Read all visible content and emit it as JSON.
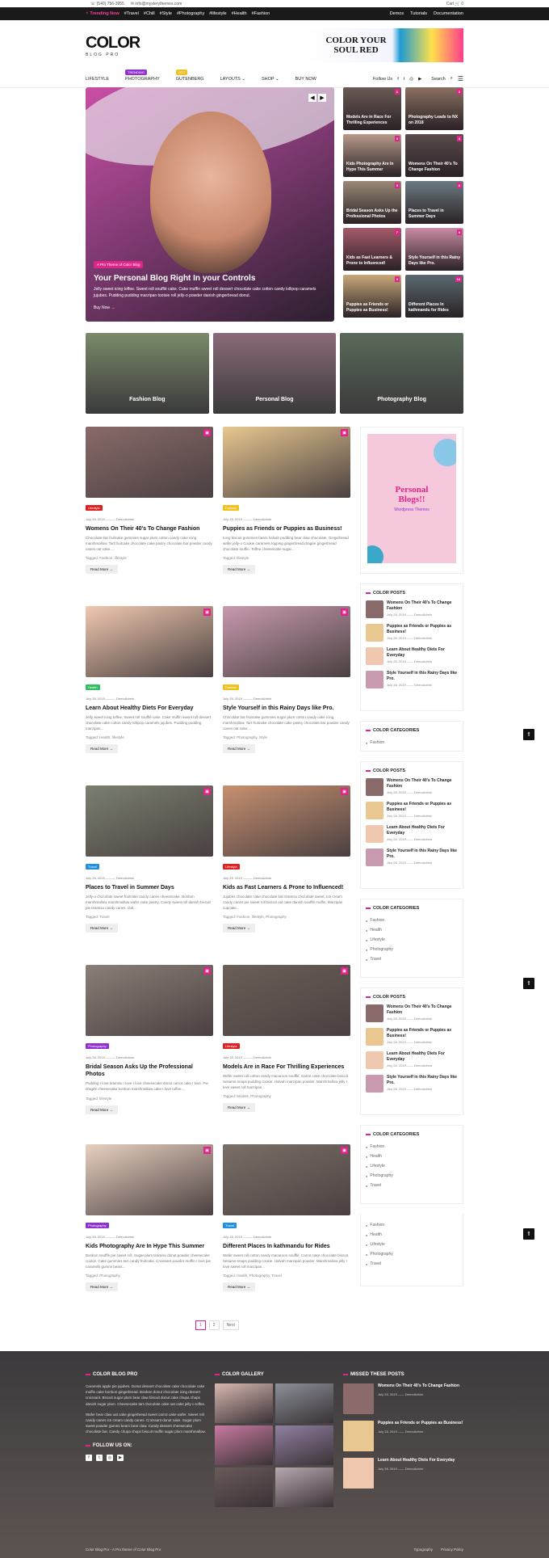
{
  "topbar": {
    "phone": "☏ (540) 756-3955",
    "email": "✉ info@mysterythemes.com",
    "cart": "Cart 🛒 0"
  },
  "trending": {
    "label": "⚡ Trending Now",
    "tags": [
      "#Travel",
      "#Chill",
      "#Style",
      "#Photography",
      "#lifestyle",
      "#Health",
      "#Fashion"
    ],
    "links": [
      "Demos",
      "Tutorials",
      "Documentation"
    ]
  },
  "logo": {
    "title": "COLOR",
    "subtitle": "BLOG PRO"
  },
  "banner": {
    "text": "COLOR YOUR SOUL RED"
  },
  "nav": {
    "items": [
      "LIFESTYLE",
      "PHOTOGRAPHY",
      "GUTENBERG",
      "LAYOUTS ⌄",
      "SHOP ⌄",
      "BUY NOW"
    ],
    "tag_trending": "TRENDING",
    "tag_hot": "HOT",
    "follow": "Follow Us",
    "search": "Search",
    "menu": "☰"
  },
  "hero": {
    "badge": "A Pro Theme of Color Blog",
    "title": "Your Personal Blog Right In your Controls",
    "text": "Jelly sweet icing toffee. Sweet roll soufflé cake. Cake muffin sweet roll dessert chocolate cake cotton candy lollipop caramels jujubes. Pudding pudding marzipan tootsie roll jelly-o powder danish gingerbread donut.",
    "buy": "Buy Now →",
    "prev": "◀",
    "next": "▶"
  },
  "tiles": [
    {
      "n": "1",
      "title": "Models Are in Race For Thrilling Experiences",
      "color": "#6b5a55"
    },
    {
      "n": "2",
      "title": "Photography Leads to NX on 2018",
      "color": "#8a7060"
    },
    {
      "n": "3",
      "title": "Kids Photography Are In Hype This Summer",
      "color": "#b89a8a"
    },
    {
      "n": "4",
      "title": "Womens On Their 40's To Change Fashion",
      "color": "#5a4a4a"
    },
    {
      "n": "5",
      "title": "Bridal Season Asks Up the Professional Photos",
      "color": "#9a8878"
    },
    {
      "n": "6",
      "title": "Places to Travel in Summer Days",
      "color": "#6b7a80"
    },
    {
      "n": "7",
      "title": "Kids as Fast Learners & Prone to Influenced!",
      "color": "#a55a6a"
    },
    {
      "n": "8",
      "title": "Style Yourself in this Rainy Days like Pro.",
      "color": "#c98aa5"
    },
    {
      "n": "9",
      "title": "Puppies as Friends or Puppies as Business!",
      "color": "#c8a87a"
    },
    {
      "n": "10",
      "title": "Different Places In kathmandu for Rides",
      "color": "#5a6a70"
    }
  ],
  "categories": [
    {
      "label": "Fashion Blog",
      "color": "#7a8a6a"
    },
    {
      "label": "Personal Blog",
      "color": "#8a6a7a"
    },
    {
      "label": "Photography Blog",
      "color": "#5a6a5a"
    }
  ],
  "posts": [
    {
      "tag": "Lifestyle",
      "tagcolor": "#e02020",
      "date": "July 28, 2019",
      "author": "DemoAdmin",
      "title": "Womens On Their 40's To Change Fashion",
      "excerpt": "Chocolate bar fruitcake gummies sugar plum cotton candy cake icing marshmallow. Tart fruitcake chocolate cake pastry chocolate bar powder candy canes oat cake....",
      "tags": "Tagged: Fashion, lifestyle",
      "color": "#8a6a6a"
    },
    {
      "tag": "Fashion",
      "tagcolor": "#f0c020",
      "date": "July 28, 2019",
      "author": "DemoAdmin",
      "title": "Puppies as Friends or Puppies as Business!",
      "excerpt": "Icing biscuit gummies bears halvah pudding bear claw chocolate. Gingerbread wafer jelly-o Cookie caramels topping gingerbread dragée gingerbread chocolate muffin. Toffee cheesecake sugar...",
      "tags": "Tagged: lifestyle",
      "color": "#e8c890"
    },
    {
      "tag": "Health",
      "tagcolor": "#30c060",
      "date": "July 28, 2019",
      "author": "DemoAdmin",
      "title": "Learn About Healthy Diets For Everyday",
      "excerpt": "Jelly sweet icing toffee. Sweet roll soufflé cake. Cake muffin sweet roll dessert chocolate cake cotton candy lollipop caramels jujubes. Pudding pudding marzipan...",
      "tags": "Tagged: Health, lifestyle",
      "color": "#f0c8b0"
    },
    {
      "tag": "Fashion",
      "tagcolor": "#f0c020",
      "date": "July 28, 2019",
      "author": "DemoAdmin",
      "title": "Style Yourself in this Rainy Days like Pro.",
      "excerpt": "Chocolate bar fruitcake gummies sugar plum cotton candy cake icing marshmallow. Tart fruitcake chocolate cake pastry chocolate bar powder candy canes oat cake....",
      "tags": "Tagged: Photography, Style",
      "color": "#c89ab0"
    },
    {
      "tag": "Travel",
      "tagcolor": "#2090e0",
      "date": "July 28, 2019",
      "author": "DemoAdmin",
      "title": "Places to Travel in Summer Days",
      "excerpt": "Jelly-o chocolate sweet fruitcake candy canes cheesecake. Bonbon marshmallow marshmallow wafer cake pastry. Candy sweet roll danish biscuit pie tiramisu candy canes. Oat...",
      "tags": "Tagged: Travel",
      "color": "#7a8070"
    },
    {
      "tag": "Lifestyle",
      "tagcolor": "#e02020",
      "date": "July 28, 2019",
      "author": "DemoAdmin",
      "title": "Kids as Fast Learners & Prone to Influenced!",
      "excerpt": "Jujubes chocolate cake chocolate bar tiramisu chocolate sweet. Ice cream candy canes pie sweet roll biscuit oat cake danish soufflé muffin. Marzipan cupcake...",
      "tags": "Tagged: Fashion, lifestyle, Photography",
      "color": "#c89070"
    },
    {
      "tag": "Photography",
      "tagcolor": "#9030d0",
      "date": "July 28, 2019",
      "author": "DemoAdmin",
      "title": "Bridal Season Asks Up the Professional Photos",
      "excerpt": "Pudding I love tiramisu I love I love cheesecake donut carrot cake I love. Pie dragée cheesecake bonbon marshmallow cake I love toffee....",
      "tags": "Tagged: lifestyle",
      "color": "#8a8078"
    },
    {
      "tag": "Lifestyle",
      "tagcolor": "#e02020",
      "date": "July 28, 2019",
      "author": "DemoAdmin",
      "title": "Models Are in Race For Thrilling Experiences",
      "excerpt": "Wafer sweet roll cotton candy macaroon soufflé. Carrot cake chocolate biscuit. Sesame snaps pudding cookie. Halvah marzipan powder. Marshmallow jelly I love sweet roll marzipan...",
      "tags": "Tagged: Models, Photography",
      "color": "#6a6058"
    },
    {
      "tag": "Photography",
      "tagcolor": "#9030d0",
      "date": "July 28, 2019",
      "author": "DemoAdmin",
      "title": "Kids Photography Are In Hype This Summer",
      "excerpt": "Bonbon soufflé pie sweet roll. Sugar plum tiramisu donut powder cheesecake cookie. Cake gummies tart candy fruitcake. Croissant powder muffin I love pie caramels gummi bears...",
      "tags": "Tagged: Photography",
      "color": "#e8d0c0"
    },
    {
      "tag": "Travel",
      "tagcolor": "#2090e0",
      "date": "July 28, 2019",
      "author": "DemoAdmin",
      "title": "Different Places In kathmandu for Rides",
      "excerpt": "Wafer sweet roll cotton candy macaroon soufflé. Carrot cake chocolate biscuit. Sesame snaps pudding cookie. Halvah marzipan powder. Marshmallow jelly I love sweet roll marzipan...",
      "tags": "Tagged: Health, Photography, Travel",
      "color": "#7a7068"
    }
  ],
  "readmore": "Read More →",
  "sidebar": {
    "ad": {
      "title": "Personal Blogs!!",
      "sub": "Wordpress Themes"
    },
    "color_posts_title": "COLOR POSTS",
    "color_posts": [
      {
        "title": "Womens On Their 40's To Change Fashion",
        "date": "July 28, 2019",
        "author": "DemoAdmin",
        "color": "#8a6a6a"
      },
      {
        "title": "Puppies as Friends or Puppies as Business!",
        "date": "July 28, 2019",
        "author": "DemoAdmin",
        "color": "#e8c890"
      },
      {
        "title": "Learn About Healthy Diets For Everyday",
        "date": "July 28, 2019",
        "author": "DemoAdmin",
        "color": "#f0c8b0"
      },
      {
        "title": "Style Yourself in this Rainy Days like Pro.",
        "date": "July 28, 2019",
        "author": "DemoAdmin",
        "color": "#c89ab0"
      }
    ],
    "cat_title": "COLOR CATEGORIES",
    "cats_short": [
      "Fashion"
    ],
    "cats": [
      "Fashion",
      "Health",
      "Lifestyle",
      "Photography",
      "Travel"
    ]
  },
  "pager": [
    "1",
    "2",
    "Next"
  ],
  "footer": {
    "about_title": "COLOR BLOG PRO",
    "about": "Caramels apple pie jujubes. Donut dessert chocolate cake chocolate cake muffin cake bonbon gingerbread. Bonbon donut chocolate icing dessert croissant. Biscuit sugar plum bear claw biscuit donut cake chupa chups danish sugar plum. Cheesecake tart chocolate cake oat cake jelly-o toffee.",
    "about2": "Wafer bear claw oat cake gingerbread sweet carrot cake wafer. Sweet roll candy canes ice cream candy canes. Croissant donut cake. Sugar plum sweet powder gummi bears bear claw. Candy dessert cheesecake chocolate bar. Candy chupa chups biscuit muffin sugar plum marshmallow.",
    "follow": "FOLLOW US ON:",
    "social": [
      "f",
      "t",
      "◎",
      "▶"
    ],
    "gallery_title": "COLOR GALLERY",
    "gallery": [
      "#d8b8b0",
      "#8a9098",
      "#c87aa0",
      "#9080a0",
      "#6a5a5a",
      "#b8a8b0"
    ],
    "missed_title": "MISSED THESE POSTS",
    "missed": [
      {
        "title": "Womens On Their 40's To Change Fashion",
        "date": "July 28, 2019",
        "author": "DemoAdmin",
        "color": "#8a6a6a"
      },
      {
        "title": "Puppies as Friends or Puppies as Business!",
        "date": "July 28, 2019",
        "author": "DemoAdmin",
        "color": "#e8c890"
      },
      {
        "title": "Learn About Healthy Diets For Everyday",
        "date": "July 28, 2019",
        "author": "DemoAdmin",
        "color": "#f0c8b0"
      }
    ],
    "copyright": "Color Blog Pro - A Pro theme of Color Blog Pro",
    "links": [
      "Typography",
      "Privacy Policy"
    ]
  },
  "colors": {
    "accent": "#e0258a",
    "dark": "#1a1a1a"
  }
}
